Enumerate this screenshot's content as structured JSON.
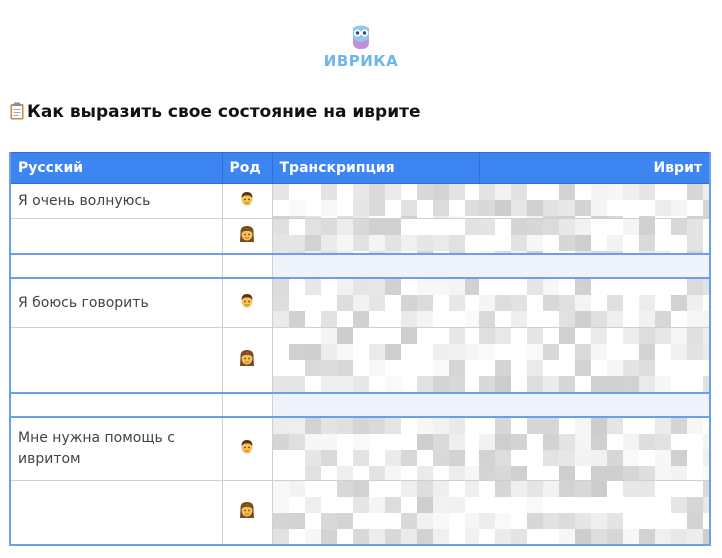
{
  "brand": {
    "logo_text": "ИВРИКА"
  },
  "page_title": "Как выразить свое состояние на иврите",
  "table": {
    "headers": {
      "russian": "Русский",
      "gender": "Род",
      "transcription": "Транскрипция",
      "hebrew": "Иврит"
    },
    "rows": [
      {
        "russian": "Я очень волнуюсь",
        "gender": "male"
      },
      {
        "russian": "",
        "gender": "female"
      },
      {
        "russian": "Я боюсь говорить",
        "gender": "male"
      },
      {
        "russian": "",
        "gender": "female"
      },
      {
        "russian": "Мне нужна помощь с ивритом",
        "gender": "male"
      },
      {
        "russian": "",
        "gender": "female"
      }
    ]
  },
  "icons": [
    "owl-logo-icon",
    "clipboard-icon",
    "man-icon",
    "woman-icon"
  ],
  "colors": {
    "header_bg": "#3d85f0",
    "border_accent": "#6d9eeb",
    "logo": "#6fb6e8"
  }
}
